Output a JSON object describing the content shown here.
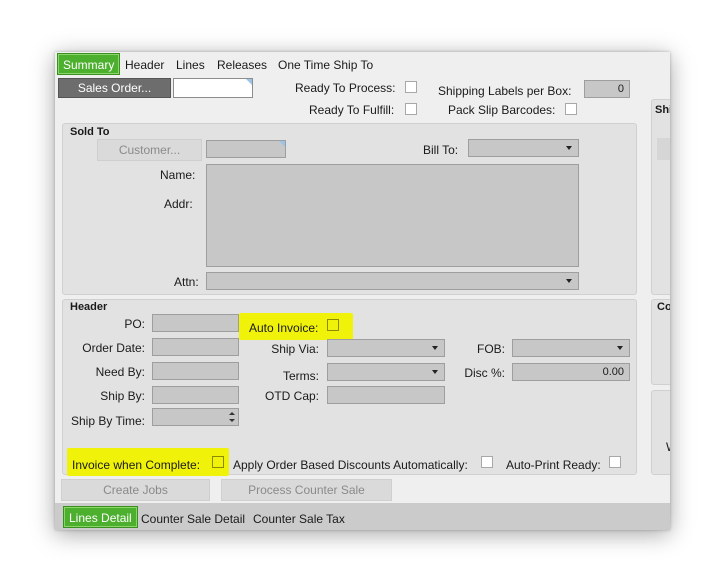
{
  "tabs": {
    "summary": "Summary",
    "header": "Header",
    "lines": "Lines",
    "releases": "Releases",
    "one_time_ship_to": "One Time Ship To"
  },
  "top": {
    "sales_order_button": "Sales Order...",
    "sales_order_value": "",
    "ready_to_process": "Ready To Process:",
    "ready_to_fulfill": "Ready To Fulfill:",
    "shipping_labels_per_box": "Shipping Labels per Box:",
    "shipping_labels_value": "0",
    "pack_slip_barcodes": "Pack Slip Barcodes:"
  },
  "sold_to": {
    "title": "Sold To",
    "customer_button": "Customer...",
    "bill_to": "Bill To:",
    "name": "Name:",
    "addr": "Addr:",
    "attn": "Attn:"
  },
  "header": {
    "title": "Header",
    "po": "PO:",
    "order_date": "Order Date:",
    "need_by": "Need By:",
    "ship_by": "Ship By:",
    "ship_by_time": "Ship By Time:",
    "auto_invoice": "Auto Invoice:",
    "ship_via": "Ship Via:",
    "terms": "Terms:",
    "otd_cap": "OTD Cap:",
    "fob": "FOB:",
    "disc_pct": "Disc %:",
    "disc_value": "0.00",
    "invoice_when_complete": "Invoice when Complete:",
    "apply_order_discounts": "Apply Order Based Discounts Automatically:",
    "auto_print_ready": "Auto-Print Ready:"
  },
  "side": {
    "ship_partial": "Shi",
    "co_partial": "Co",
    "w_partial": "W"
  },
  "actions": {
    "create_jobs": "Create Jobs",
    "process_counter_sale": "Process Counter Sale"
  },
  "bottom_tabs": {
    "lines_detail": "Lines Detail",
    "counter_sale_detail": "Counter Sale Detail",
    "counter_sale_tax": "Counter Sale Tax"
  },
  "colors": {
    "accent_green": "#4caf2e",
    "highlight_yellow": "#f0f20a"
  }
}
